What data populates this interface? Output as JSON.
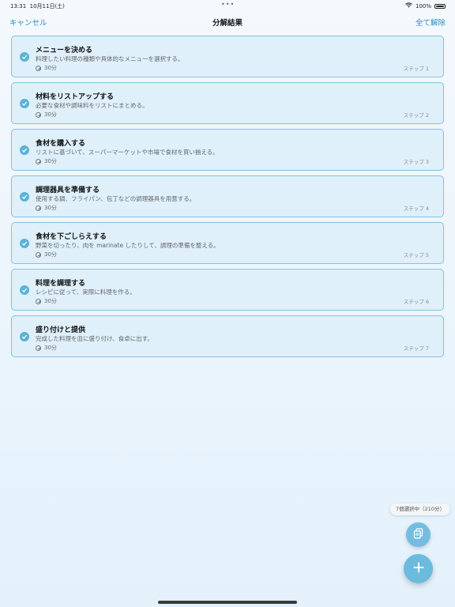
{
  "status": {
    "time": "13:31",
    "date": "10月11日(土)",
    "dots": "•••",
    "battery": "100%"
  },
  "nav": {
    "cancel": "キャンセル",
    "title": "分解結果",
    "deselect_all": "全て解除"
  },
  "steps": [
    {
      "title": "メニューを決める",
      "desc": "料理したい料理の種類や具体的なメニューを選択する。",
      "time": "30分",
      "num": "ステップ 1"
    },
    {
      "title": "材料をリストアップする",
      "desc": "必要な食材や調味料をリストにまとめる。",
      "time": "30分",
      "num": "ステップ 2"
    },
    {
      "title": "食材を購入する",
      "desc": "リストに基づいて、スーパーマーケットや市場で食材を買い揃える。",
      "time": "30分",
      "num": "ステップ 3"
    },
    {
      "title": "調理器具を準備する",
      "desc": "使用する鍋、フライパン、包丁などの調理器具を用意する。",
      "time": "30分",
      "num": "ステップ 4"
    },
    {
      "title": "食材を下ごしらえする",
      "desc": "野菜を切ったり、肉を marinate したりして、調理の準備を整える。",
      "time": "30分",
      "num": "ステップ 5"
    },
    {
      "title": "料理を調理する",
      "desc": "レシピに従って、実際に料理を作る。",
      "time": "30分",
      "num": "ステップ 6"
    },
    {
      "title": "盛り付けと提供",
      "desc": "完成した料理を皿に盛り付け、食卓に出す。",
      "time": "30分",
      "num": "ステップ 7"
    }
  ],
  "selection": {
    "summary": "7個選択中（210分）"
  },
  "icons": {
    "check": "checkmark-icon",
    "clock": "clock-icon",
    "copy": "copy-icon",
    "add": "plus-icon"
  },
  "colors": {
    "accent": "#2a8ac7",
    "card_bg": "#dff0fb",
    "card_border": "#7ec4de",
    "check": "#5ab3d6"
  }
}
